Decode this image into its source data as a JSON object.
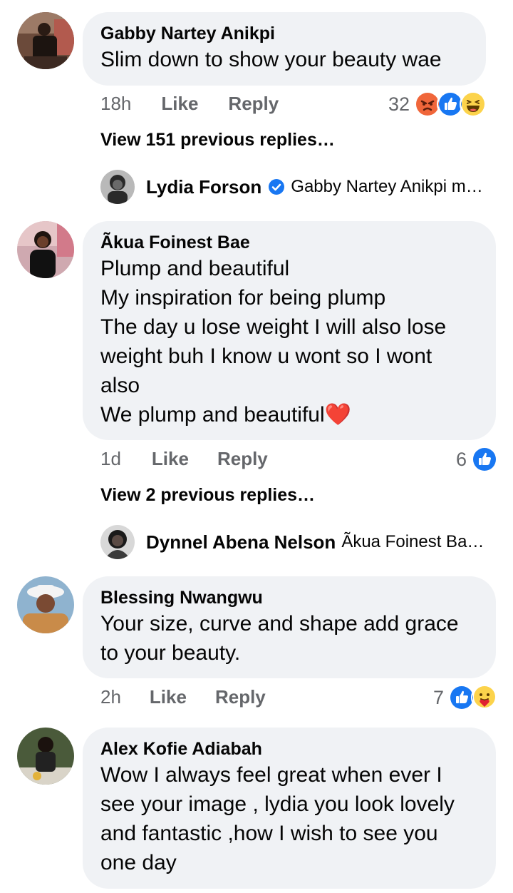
{
  "comments": [
    {
      "author": "Gabby Nartey Anikpi",
      "text": "Slim down to show your beauty wae",
      "time": "18h",
      "like": "Like",
      "reply": "Reply",
      "reaction_count": "32",
      "reactions": [
        "angry-icon",
        "like-icon",
        "haha-icon"
      ],
      "view_previous": "View 151 previous replies…",
      "latest_reply": {
        "author": "Lydia Forson",
        "verified": true,
        "text": "Gabby Nartey Anikpi m…"
      }
    },
    {
      "author": "Ãkua Foinest Bae",
      "text": "Plump and beautiful\nMy inspiration for being plump\nThe day u lose weight I will also lose\nweight buh I know u wont so I wont\nalso\nWe plump and beautiful",
      "emoji": "❤️",
      "time": "1d",
      "like": "Like",
      "reply": "Reply",
      "reaction_count": "6",
      "reactions": [
        "like-icon"
      ],
      "view_previous": "View 2 previous replies…",
      "latest_reply": {
        "author": "Dynnel Abena Nelson",
        "verified": false,
        "text": "Ãkua Foinest Ba…"
      }
    },
    {
      "author": "Blessing Nwangwu",
      "text": "Your size, curve and shape add grace\nto your beauty.",
      "time": "2h",
      "like": "Like",
      "reply": "Reply",
      "reaction_count": "7",
      "reactions": [
        "like-icon",
        "care-icon"
      ]
    },
    {
      "author": "Alex Kofie Adiabah",
      "text": "Wow I always feel great when ever I\nsee your image , lydia you look lovely\nand fantastic ,how I wish to see you\none day"
    }
  ],
  "colors": {
    "bubble": "#f0f2f5",
    "meta_text": "#65676b",
    "like_blue": "#1877f2",
    "angry_orange": "#f0663a",
    "haha_yellow": "#fcd34b",
    "heart_red": "#e0212f"
  }
}
